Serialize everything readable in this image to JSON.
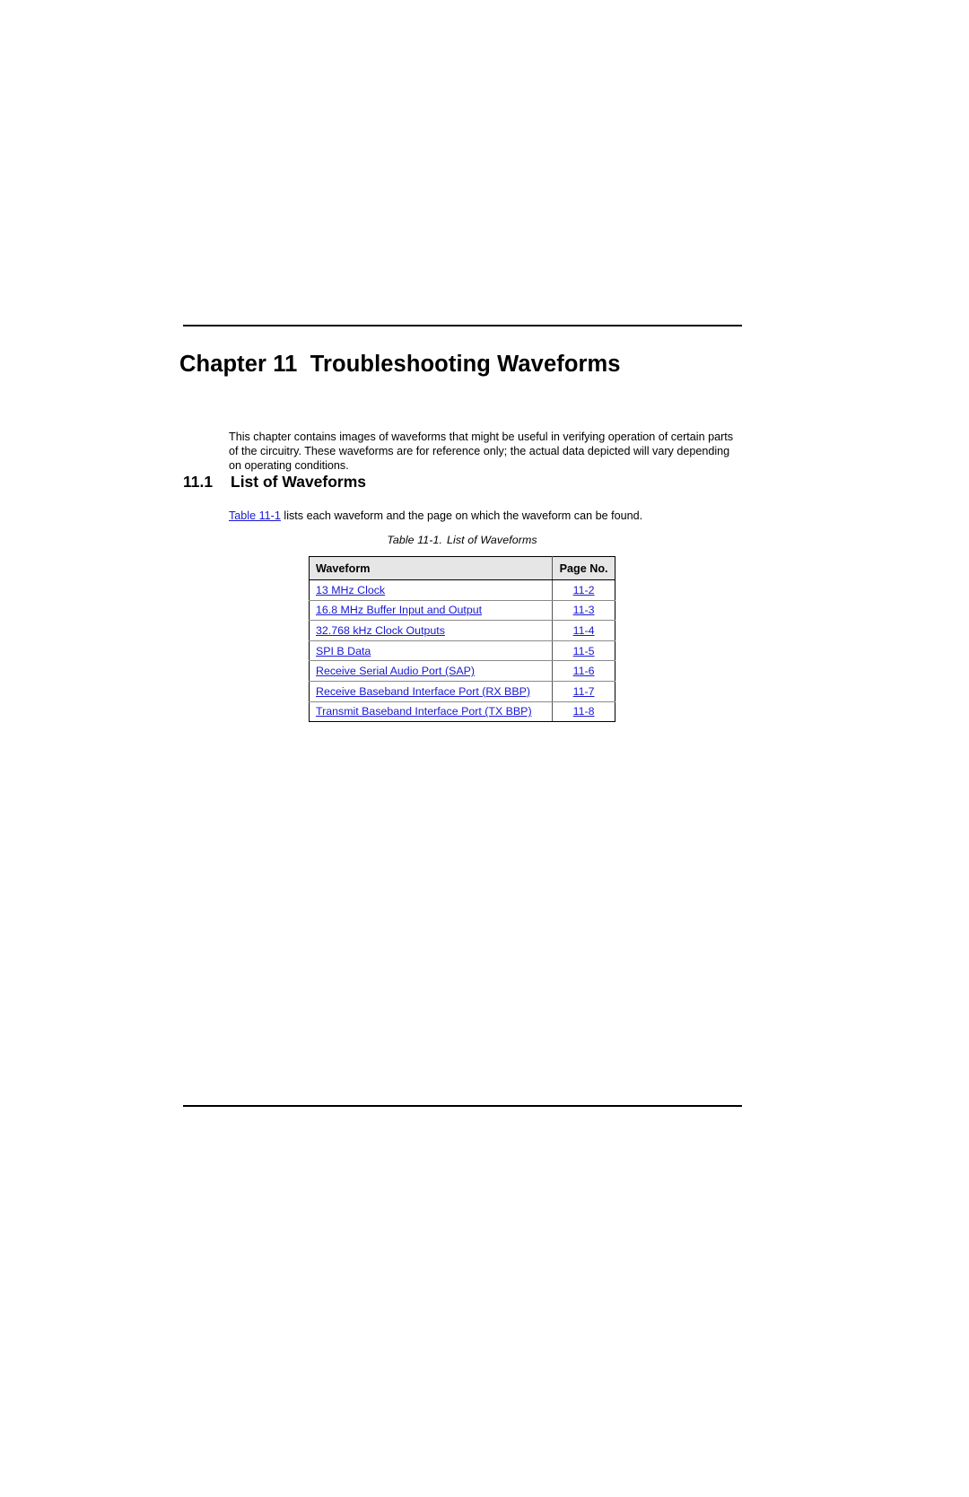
{
  "chapter": {
    "heading": "Chapter 11  Troubleshooting Waveforms",
    "intro": "This chapter contains images of waveforms that might be useful in verifying operation of certain parts of the circuitry. These waveforms are for reference only; the actual data depicted will vary depending on operating conditions."
  },
  "section": {
    "number": "11.1",
    "title": "List of Waveforms",
    "xref": "Table 11-1",
    "body_after_xref": " lists each waveform and the page on which the waveform can be found."
  },
  "table": {
    "caption_label": "Table 11-1.",
    "caption_title": "List of Waveforms",
    "columns": [
      "Waveform",
      "Page No."
    ],
    "rows": [
      {
        "waveform": "13 MHz Clock",
        "page": "11-2"
      },
      {
        "waveform": "16.8 MHz Buffer Input and Output",
        "page": "11-3"
      },
      {
        "waveform": "32.768 kHz Clock Outputs",
        "page": "11-4"
      },
      {
        "waveform": "SPI B Data",
        "page": "11-5"
      },
      {
        "waveform": "Receive Serial Audio Port (SAP)",
        "page": "11-6"
      },
      {
        "waveform": "Receive Baseband Interface Port (RX BBP)",
        "page": "11-7"
      },
      {
        "waveform": "Transmit Baseband Interface Port (TX BBP)",
        "page": "11-8"
      }
    ]
  },
  "colors": {
    "link": "#1818d4",
    "header_fill": "#e6e6e6",
    "rule": "#000000"
  }
}
